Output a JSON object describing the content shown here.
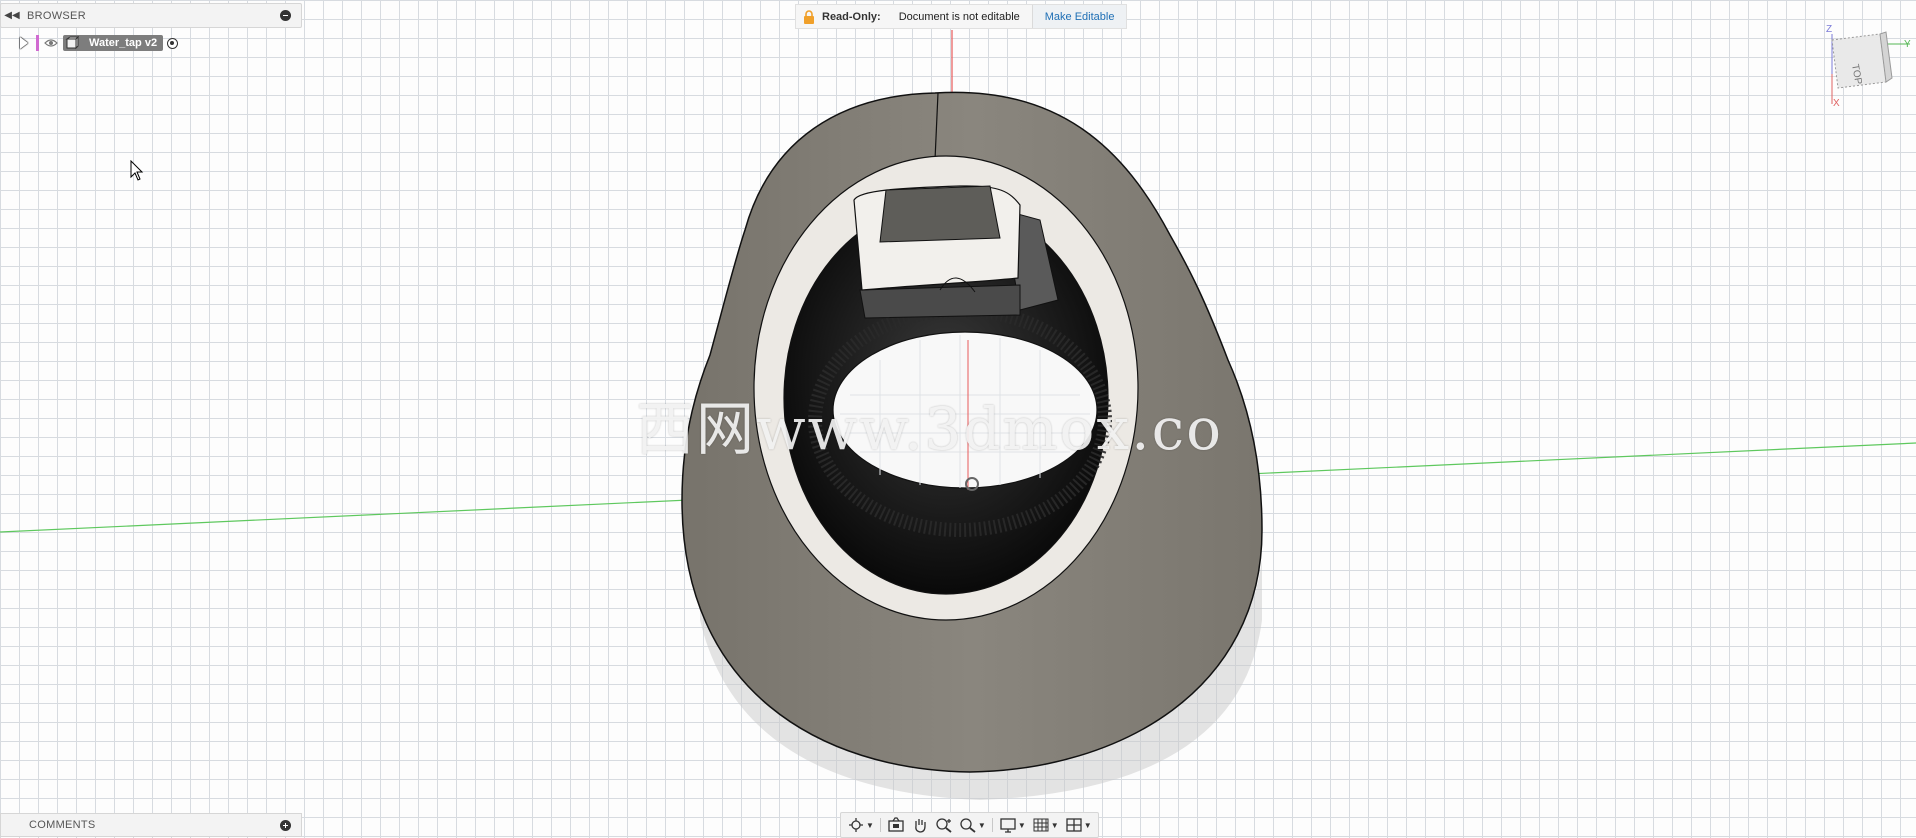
{
  "browser": {
    "title": "BROWSER",
    "component": {
      "name": "Water_tap v2"
    }
  },
  "banner": {
    "label": "Read-Only:",
    "message": "Document is not editable",
    "action": "Make Editable"
  },
  "viewcube": {
    "face": "TOP",
    "axis_z": "Z",
    "axis_y": "Y",
    "axis_x": "X"
  },
  "comments": {
    "title": "COMMENTS"
  },
  "watermark": {
    "text": "西网www.3dmox.co"
  },
  "colors": {
    "body": "#86827a",
    "face": "#ece9e4",
    "grid": "#d7dbe0",
    "axis_red": "#e85a5a",
    "axis_green": "#5ec85e",
    "link": "#1f6fb5",
    "lock": "#f0a02a"
  },
  "toolbar": {
    "icons": [
      "orbit-icon",
      "look-at-icon",
      "pan-icon",
      "zoom-icon",
      "fit-icon",
      "display-settings-icon",
      "grid-icon",
      "viewports-icon"
    ]
  }
}
